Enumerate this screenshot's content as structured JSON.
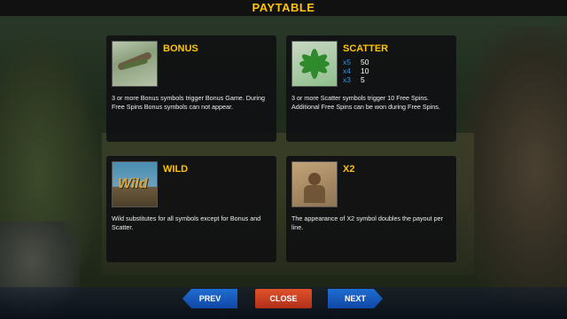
{
  "header": {
    "title": "PAYTABLE"
  },
  "symbols": [
    {
      "name": "BONUS",
      "icon": "snake-on-branch-icon",
      "description": "3 or more Bonus symbols trigger Bonus Game. During Free Spins Bonus symbols can not appear."
    },
    {
      "name": "SCATTER",
      "icon": "palm-leaves-icon",
      "payouts": [
        {
          "mult": "x5",
          "value": "50"
        },
        {
          "mult": "x4",
          "value": "10"
        },
        {
          "mult": "x3",
          "value": "5"
        }
      ],
      "description": "3 or more Scatter symbols trigger 10 Free Spins. Additional Free Spins can be won during Free Spins."
    },
    {
      "name": "WILD",
      "icon": "wild-sign-icon",
      "icon_text": "Wild",
      "description": "Wild substitutes for all symbols except for Bonus and Scatter."
    },
    {
      "name": "X2",
      "icon": "explorer-in-sand-icon",
      "description": "The appearance of X2 symbol doubles the payout per line."
    }
  ],
  "nav": {
    "prev_label": "PREV",
    "close_label": "CLOSE",
    "next_label": "NEXT"
  },
  "colors": {
    "title": "#ffc400",
    "multiplier": "#3a8fd8",
    "nav_button": "#1f6dd1",
    "close_button": "#e0512a"
  }
}
